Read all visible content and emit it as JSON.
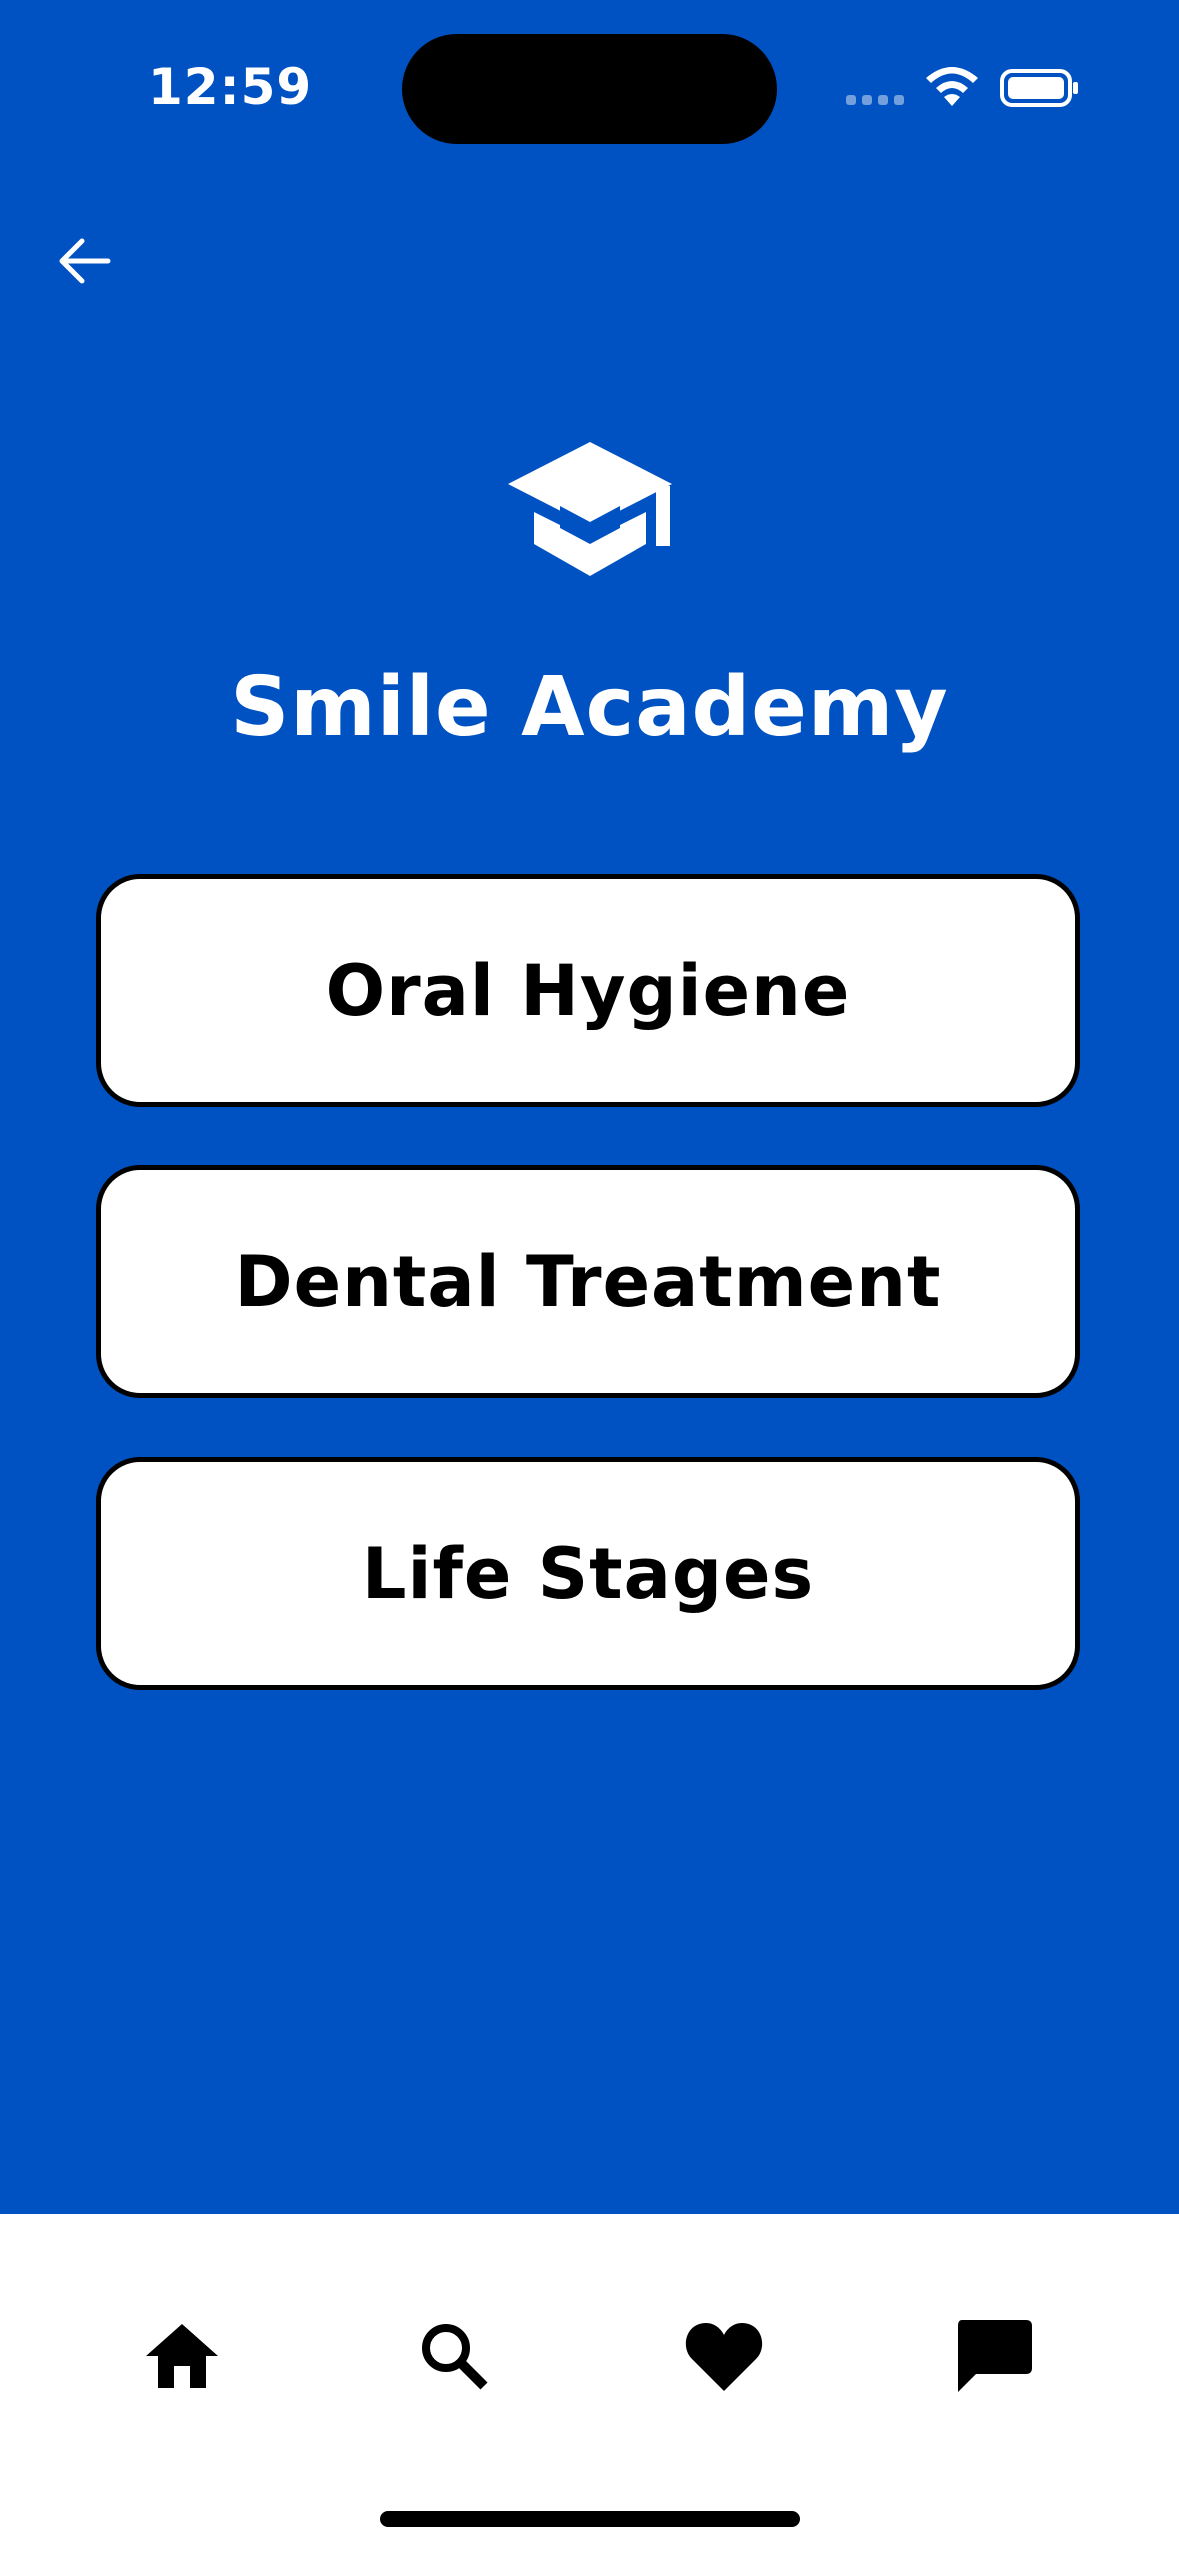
{
  "status_bar": {
    "time": "12:59"
  },
  "header": {
    "back_icon": "arrow-left-icon",
    "logo_icon": "graduation-cap-icon",
    "title": "Smile Academy"
  },
  "topics": [
    {
      "label": "Oral Hygiene"
    },
    {
      "label": "Dental Treatment"
    },
    {
      "label": "Life Stages"
    }
  ],
  "tabbar": {
    "icons": [
      "home-icon",
      "search-icon",
      "heart-icon",
      "chat-icon"
    ]
  },
  "colors": {
    "background": "#0052C2",
    "button_bg": "#FFFFFF",
    "button_border": "#000000",
    "tabbar_bg": "#FFFFFF"
  }
}
